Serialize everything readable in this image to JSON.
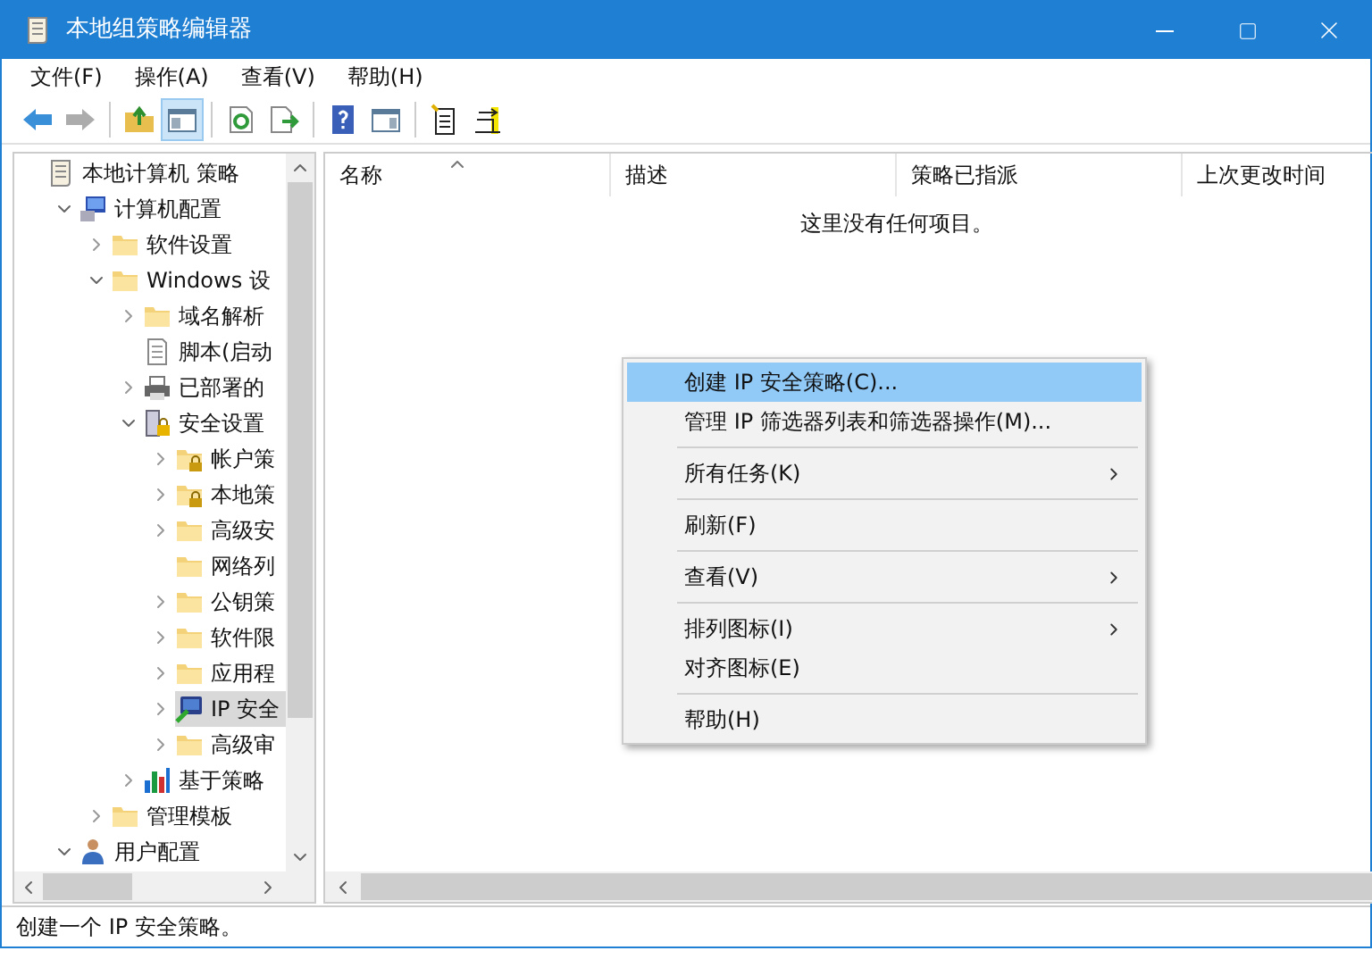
{
  "window": {
    "title": "本地组策略编辑器"
  },
  "menu_bar": [
    "文件(F)",
    "操作(A)",
    "查看(V)",
    "帮助(H)"
  ],
  "toolbar": [
    [
      {
        "kind": "back",
        "disabled": false,
        "pressed": false
      },
      {
        "kind": "forward",
        "disabled": true,
        "pressed": false
      }
    ],
    [
      {
        "kind": "up",
        "disabled": false,
        "pressed": false
      },
      {
        "kind": "tree-toggle",
        "disabled": false,
        "pressed": true
      }
    ],
    [
      {
        "kind": "refresh",
        "disabled": false,
        "pressed": false
      },
      {
        "kind": "export",
        "disabled": false,
        "pressed": false
      }
    ],
    [
      {
        "kind": "help",
        "disabled": false,
        "pressed": false
      },
      {
        "kind": "action-pane",
        "disabled": false,
        "pressed": false
      }
    ],
    [
      {
        "kind": "new-policy",
        "disabled": false,
        "pressed": false
      },
      {
        "kind": "assign",
        "disabled": false,
        "pressed": false
      }
    ]
  ],
  "tree": [
    {
      "label": "本地计算机 策略",
      "kind": "policy",
      "selected": false,
      "children": [
        {
          "label": "计算机配置",
          "kind": "computer",
          "expanded": true,
          "selected": false,
          "children": [
            {
              "label": "软件设置",
              "kind": "folder",
              "expanded": false,
              "selected": false
            },
            {
              "label": "Windows 设",
              "kind": "folder",
              "expanded": true,
              "selected": false,
              "children": [
                {
                  "label": "域名解析",
                  "kind": "folder",
                  "expanded": false,
                  "selected": false
                },
                {
                  "label": "脚本(启动",
                  "kind": "script",
                  "selected": false
                },
                {
                  "label": "已部署的",
                  "kind": "printer",
                  "expanded": false,
                  "selected": false
                },
                {
                  "label": "安全设置",
                  "kind": "security",
                  "expanded": true,
                  "selected": false,
                  "children": [
                    {
                      "label": "帐户策",
                      "kind": "lock-folder",
                      "expanded": false,
                      "selected": false
                    },
                    {
                      "label": "本地策",
                      "kind": "lock-folder",
                      "expanded": false,
                      "selected": false
                    },
                    {
                      "label": "高级安",
                      "kind": "folder",
                      "expanded": false,
                      "selected": false
                    },
                    {
                      "label": "网络列",
                      "kind": "folder",
                      "selected": false
                    },
                    {
                      "label": "公钥策",
                      "kind": "folder",
                      "expanded": false,
                      "selected": false
                    },
                    {
                      "label": "软件限",
                      "kind": "folder",
                      "expanded": false,
                      "selected": false
                    },
                    {
                      "label": "应用程",
                      "kind": "folder",
                      "expanded": false,
                      "selected": false
                    },
                    {
                      "label": "IP 安全",
                      "kind": "ipsec",
                      "expanded": false,
                      "selected": true
                    },
                    {
                      "label": "高级审",
                      "kind": "folder",
                      "expanded": false,
                      "selected": false
                    }
                  ]
                },
                {
                  "label": "基于策略",
                  "kind": "chart",
                  "expanded": false,
                  "selected": false
                }
              ]
            },
            {
              "label": "管理模板",
              "kind": "folder",
              "expanded": false,
              "selected": false
            }
          ]
        },
        {
          "label": "用户配置",
          "kind": "user",
          "expanded": true,
          "selected": false
        }
      ]
    }
  ],
  "table": {
    "columns": [
      {
        "label": "名称",
        "sorted": true
      },
      {
        "label": "描述",
        "sorted": false
      },
      {
        "label": "策略已指派",
        "sorted": false
      },
      {
        "label": "上次更改时间",
        "sorted": false
      }
    ],
    "empty_message": "这里没有任何项目。"
  },
  "context_menu": {
    "items": [
      {
        "kind": "item",
        "label": "创建 IP 安全策略(C)...",
        "submenu": false,
        "selected": true
      },
      {
        "kind": "item",
        "label": "管理 IP 筛选器列表和筛选器操作(M)...",
        "submenu": false,
        "selected": false
      },
      {
        "kind": "separator"
      },
      {
        "kind": "item",
        "label": "所有任务(K)",
        "submenu": true,
        "selected": false
      },
      {
        "kind": "separator"
      },
      {
        "kind": "item",
        "label": "刷新(F)",
        "submenu": false,
        "selected": false
      },
      {
        "kind": "separator"
      },
      {
        "kind": "item",
        "label": "查看(V)",
        "submenu": true,
        "selected": false
      },
      {
        "kind": "separator"
      },
      {
        "kind": "item",
        "label": "排列图标(I)",
        "submenu": true,
        "selected": false
      },
      {
        "kind": "item",
        "label": "对齐图标(E)",
        "submenu": false,
        "selected": false
      },
      {
        "kind": "separator"
      },
      {
        "kind": "item",
        "label": "帮助(H)",
        "submenu": false,
        "selected": false
      }
    ]
  },
  "status_bar": "创建一个 IP 安全策略。"
}
